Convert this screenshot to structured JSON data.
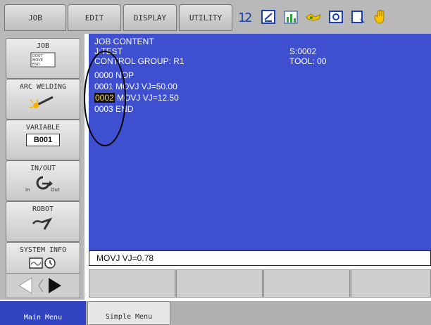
{
  "menubar": {
    "tabs": [
      {
        "label": "JOB"
      },
      {
        "label": "EDIT"
      },
      {
        "label": "DISPLAY"
      },
      {
        "label": "UTILITY"
      }
    ],
    "toolbar_icons": [
      "numbering-icon",
      "edit-sheet-icon",
      "chart-icon",
      "handshake-icon",
      "tool-icon",
      "screen-icon",
      "hand-icon"
    ]
  },
  "sidebar": {
    "job": {
      "label": "JOB",
      "icon_lines": [
        "DOUT",
        "MOVE",
        "END"
      ]
    },
    "arc": {
      "label": "ARC WELDING"
    },
    "variable": {
      "label": "VARIABLE",
      "value": "B001"
    },
    "inout": {
      "label": "IN/OUT",
      "in": "In",
      "out": "Out"
    },
    "robot": {
      "label": "ROBOT"
    },
    "sysinfo": {
      "label": "SYSTEM INFO"
    }
  },
  "content": {
    "title": "JOB CONTENT",
    "job_name": "J:TEST",
    "step": "S:0002",
    "control_group": "CONTROL GROUP: R1",
    "tool": "TOOL: 00",
    "lines": [
      {
        "num": "0000",
        "text": " NOP"
      },
      {
        "num": "0001",
        "text": " MOVJ VJ=50.00"
      },
      {
        "num": "0002",
        "text": " MOVJ VJ=12.50"
      },
      {
        "num": "0003",
        "text": " END"
      }
    ]
  },
  "editbar": {
    "text": "MOVJ VJ=0.78"
  },
  "bottom": {
    "main_menu": "Main Menu",
    "simple_menu": "Simple Menu"
  },
  "colors": {
    "screen": "#3e4fd0",
    "selected_line_text": "#ffd84a",
    "active_tab": "#3244c2"
  }
}
